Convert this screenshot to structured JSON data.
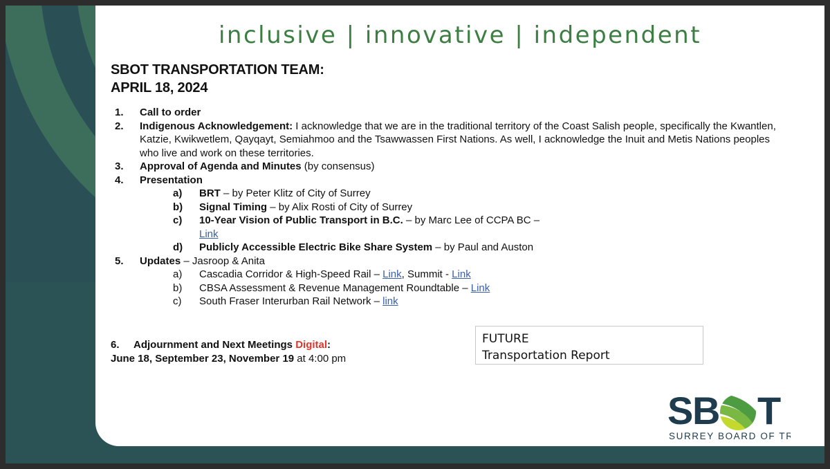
{
  "slide": {
    "tagline": "inclusive | innovative | independent",
    "title_line1": "SBOT TRANSPORTATION TEAM:",
    "title_line2": "APRIL 18, 2024",
    "colors": {
      "panel_background": "#ffffff",
      "slide_background": "#2b5255",
      "frame": "#2d2d2d",
      "tagline_green": "#3d7f42",
      "link_blue": "#3a5fad",
      "accent_red": "#e0352b",
      "arc_dark": "#2a5055",
      "arc_light": "#3d6e5c"
    }
  },
  "agenda": {
    "item1": {
      "marker": "1.",
      "title": "Call to order"
    },
    "item2": {
      "marker": "2.",
      "title": "Indigenous Acknowledgement:",
      "body": " I acknowledge that we are in the traditional territory of the Coast Salish people, specifically the Kwantlen, Katzie, Kwikwetlem, Qayqayt, Semiahmoo and the Tsawwassen First Nations. As well, I acknowledge the Inuit and Metis Nations peoples who live and work on these territories."
    },
    "item3": {
      "marker": "3.",
      "title": "Approval of Agenda and Minutes",
      "body": " (by consensus)"
    },
    "item4": {
      "marker": "4.",
      "title": "Presentation",
      "subitems": [
        {
          "marker": "a)",
          "bold": "BRT",
          "rest": " – by Peter Klitz of City of Surrey",
          "link": null
        },
        {
          "marker": "b)",
          "bold": "Signal Timing",
          "rest": " – by Alix Rosti of City of Surrey",
          "link": null
        },
        {
          "marker": "c)",
          "bold": "10-Year Vision of Public Transport in B.C.",
          "rest": " – by Marc Lee of CCPA BC – ",
          "link": "Link"
        },
        {
          "marker": "d)",
          "bold": "Publicly Accessible Electric Bike Share System",
          "rest": " – by Paul and Auston",
          "link": null
        }
      ]
    },
    "item5": {
      "marker": "5.",
      "title": "Updates",
      "body": " – Jasroop & Anita",
      "subitems": [
        {
          "marker": "a)",
          "text_before": "Cascadia Corridor & High-Speed Rail – ",
          "link1": "Link",
          "text_mid": ", Summit - ",
          "link2": "Link"
        },
        {
          "marker": "b)",
          "text_before": "CBSA Assessment & Revenue Management Roundtable – ",
          "link1": "Link",
          "text_mid": "",
          "link2": null
        },
        {
          "marker": "c)",
          "text_before": "South Fraser Interurban Rail Network – ",
          "link1": "link",
          "text_mid": "",
          "link2": null
        }
      ]
    },
    "item6": {
      "marker": "6.",
      "title": "Adjournment and Next Meetings ",
      "highlight": "Digital",
      "colon": ":",
      "dates": "June 18, September 23, November 19",
      "time": " at 4:00 pm"
    }
  },
  "future_box": {
    "line1": "FUTURE",
    "line2": "Transportation Report"
  },
  "logo": {
    "wordmark": "SBOT",
    "tagline": "SURREY BOARD OF TRADE",
    "letters": [
      "S",
      "B",
      "T"
    ],
    "colors": {
      "text": "#1e3c4e",
      "globe_dark_green": "#4d9c41",
      "globe_mid_green": "#79b843",
      "globe_light_green": "#c3d92e"
    }
  }
}
